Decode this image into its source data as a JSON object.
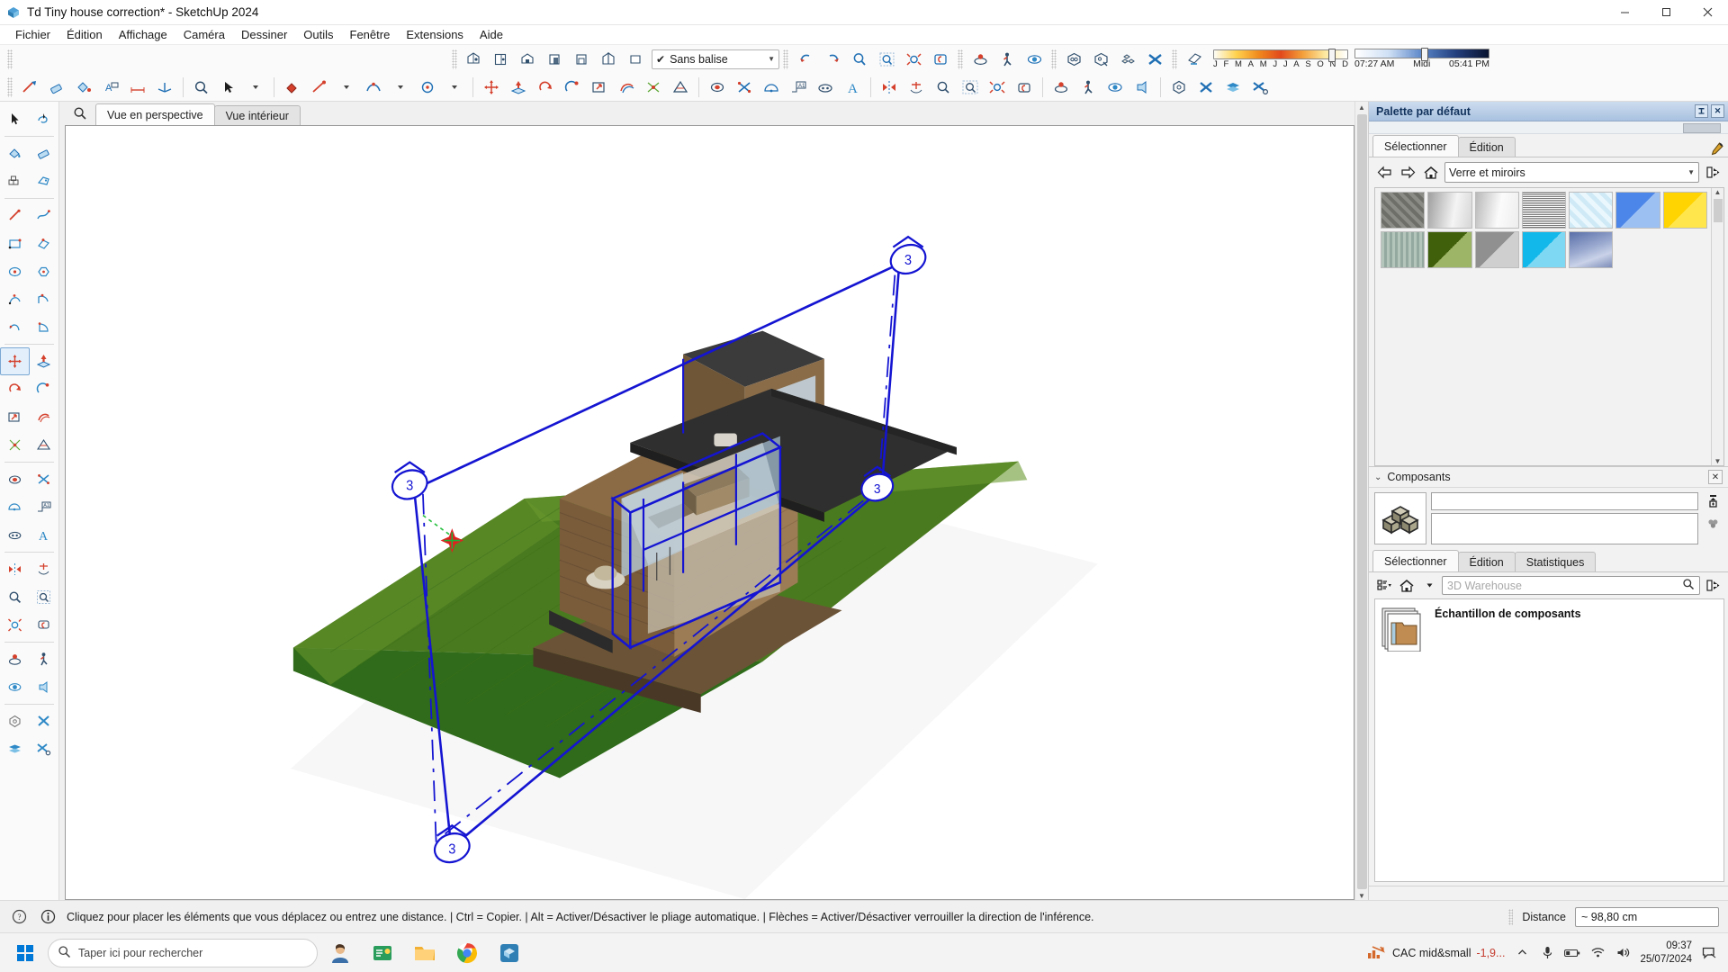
{
  "window": {
    "title": "Td Tiny house correction* - SketchUp 2024",
    "app_icon": "sketchup-logo-icon",
    "minimize": "—",
    "maximize": "▢",
    "close": "✕"
  },
  "menubar": {
    "items": [
      {
        "label": "Fichier"
      },
      {
        "label": "Édition"
      },
      {
        "label": "Affichage"
      },
      {
        "label": "Caméra"
      },
      {
        "label": "Dessiner"
      },
      {
        "label": "Outils"
      },
      {
        "label": "Fenêtre"
      },
      {
        "label": "Extensions"
      },
      {
        "label": "Aide"
      }
    ]
  },
  "toolbars": {
    "tag_selector": {
      "check": "✔",
      "label": "Sans balise",
      "arrow": "▼"
    },
    "shadow": {
      "months": [
        "J",
        "F",
        "M",
        "A",
        "M",
        "J",
        "J",
        "A",
        "S",
        "O",
        "N",
        "D"
      ],
      "sunrise": "07:27 AM",
      "noon": "Midi",
      "sunset": "05:41 PM",
      "month_thumb_pct": 86,
      "time_thumb_pct": 49
    }
  },
  "scenes": {
    "search_icon": "search-icon",
    "tabs": [
      {
        "label": "Vue en perspective",
        "active": true
      },
      {
        "label": "Vue intérieur",
        "active": false
      }
    ]
  },
  "viewport": {
    "model_name": "tiny-house-3d-model",
    "section_plane_markers": [
      "3",
      "3",
      "3",
      "3"
    ],
    "description": "Perspective view of a tiny house on a green terrain with a blue selected/moved component outline and section planes"
  },
  "materials_panel": {
    "title": "Palette par défaut",
    "pin_icon": "pin-icon",
    "close_icon": "✕",
    "tabs": [
      {
        "label": "Sélectionner",
        "active": true
      },
      {
        "label": "Édition",
        "active": false
      }
    ],
    "eyedropper_icon": "eyedropper-icon",
    "nav": {
      "back_icon": "arrow-left-icon",
      "forward_icon": "arrow-right-icon",
      "home_icon": "home-icon",
      "details_icon": "details-arrow-icon"
    },
    "library": {
      "label": "Verre et miroirs",
      "arrow": "▼"
    },
    "swatches": [
      {
        "name": "asphalt-texture",
        "css": "repeating-linear-gradient(45deg,#8c8c86 0 4px,#6f6f69 4px 8px), #7e7e78"
      },
      {
        "name": "metal-gradient-silver",
        "css": "linear-gradient(100deg,#9f9f9f,#f4f4f4 60%,#d6d6d6)"
      },
      {
        "name": "metal-gradient-light",
        "css": "linear-gradient(100deg,#b9b9b9,#fbfbfb 55%,#ededed)"
      },
      {
        "name": "noise-speckle",
        "css": "repeating-linear-gradient(0deg,#fff 0 1px,#777 1px 2px), repeating-linear-gradient(90deg,#fff 0 1px,#888 1px 2px)"
      },
      {
        "name": "glass-crosshatch-blue",
        "css": "repeating-linear-gradient(45deg,#cfeaf6 0 5px,#eaf7fd 5px 10px), repeating-linear-gradient(-45deg,#cfeaf6 0 5px,#eaf7fd 5px 10px)"
      },
      {
        "name": "glass-blue",
        "css": "linear-gradient(135deg,#4b86e8 50%,#9dc0f3 50%)"
      },
      {
        "name": "glass-yellow",
        "css": "linear-gradient(135deg,#ffd400 50%,#ffe64d 50%)"
      },
      {
        "name": "glass-striped-green",
        "css": "repeating-linear-gradient(90deg,#b4c6bc 0 3px,#94a99f 3px 6px)"
      },
      {
        "name": "glass-olive",
        "css": "linear-gradient(135deg,#41600c 50%,#9db566 50%)"
      },
      {
        "name": "glass-grey",
        "css": "linear-gradient(135deg,#909090 50%,#cfcfcf 50%)"
      },
      {
        "name": "glass-cyan",
        "css": "linear-gradient(135deg,#12b8ea 50%,#7fd8f3 50%)"
      },
      {
        "name": "sky-clouds",
        "css": "linear-gradient(160deg,#5a6fa8,#9aa9cf 45%,#c9d2e8 70%,#7d8cb8)"
      }
    ]
  },
  "components_panel": {
    "title": "Composants",
    "collapse_icon": "chevron-down-icon",
    "close_icon": "✕",
    "preview_icon": "components-cubes-icon",
    "name_value": "",
    "description_value": "",
    "side_icons": [
      "insert-component-icon",
      "component-options-icon"
    ],
    "tabs": [
      {
        "label": "Sélectionner",
        "active": true
      },
      {
        "label": "Édition",
        "active": false
      },
      {
        "label": "Statistiques",
        "active": false
      }
    ],
    "toolbar": {
      "view_options_icon": "view-options-icon",
      "home_icon": "home-icon",
      "dropdown_arrow": "▼",
      "search_placeholder": "3D Warehouse",
      "search_icon": "search-icon",
      "details_icon": "details-arrow-icon"
    },
    "list": [
      {
        "label": "Échantillon de composants",
        "icon": "folder-icon"
      }
    ]
  },
  "statusbar": {
    "help_icon": "help-circle-icon",
    "info_icon": "info-circle-icon",
    "message": "Cliquez pour placer les éléments que vous déplacez ou entrez une distance.  |  Ctrl = Copier.  |  Alt = Activer/Désactiver le pliage automatique.  |  Flèches = Activer/Désactiver verrouiller la direction de l'inférence.",
    "measure_label": "Distance",
    "measure_value": "~ 98,80 cm"
  },
  "taskbar": {
    "start_icon": "windows-start-icon",
    "search_placeholder": "Taper ici pour rechercher",
    "search_icon": "search-icon",
    "pinned": [
      {
        "name": "people-icon"
      },
      {
        "name": "news-weather-icon"
      },
      {
        "name": "file-explorer-icon"
      },
      {
        "name": "chrome-icon"
      },
      {
        "name": "sketchup-icon"
      }
    ],
    "tray": {
      "stock_label": "CAC mid&small",
      "stock_value": "-1,9...",
      "chevron": "⌃",
      "icons": [
        "microphone-icon",
        "battery-icon",
        "wifi-icon",
        "volume-icon"
      ],
      "time": "09:37",
      "date": "25/07/2024",
      "notifications_icon": "notifications-icon"
    }
  }
}
